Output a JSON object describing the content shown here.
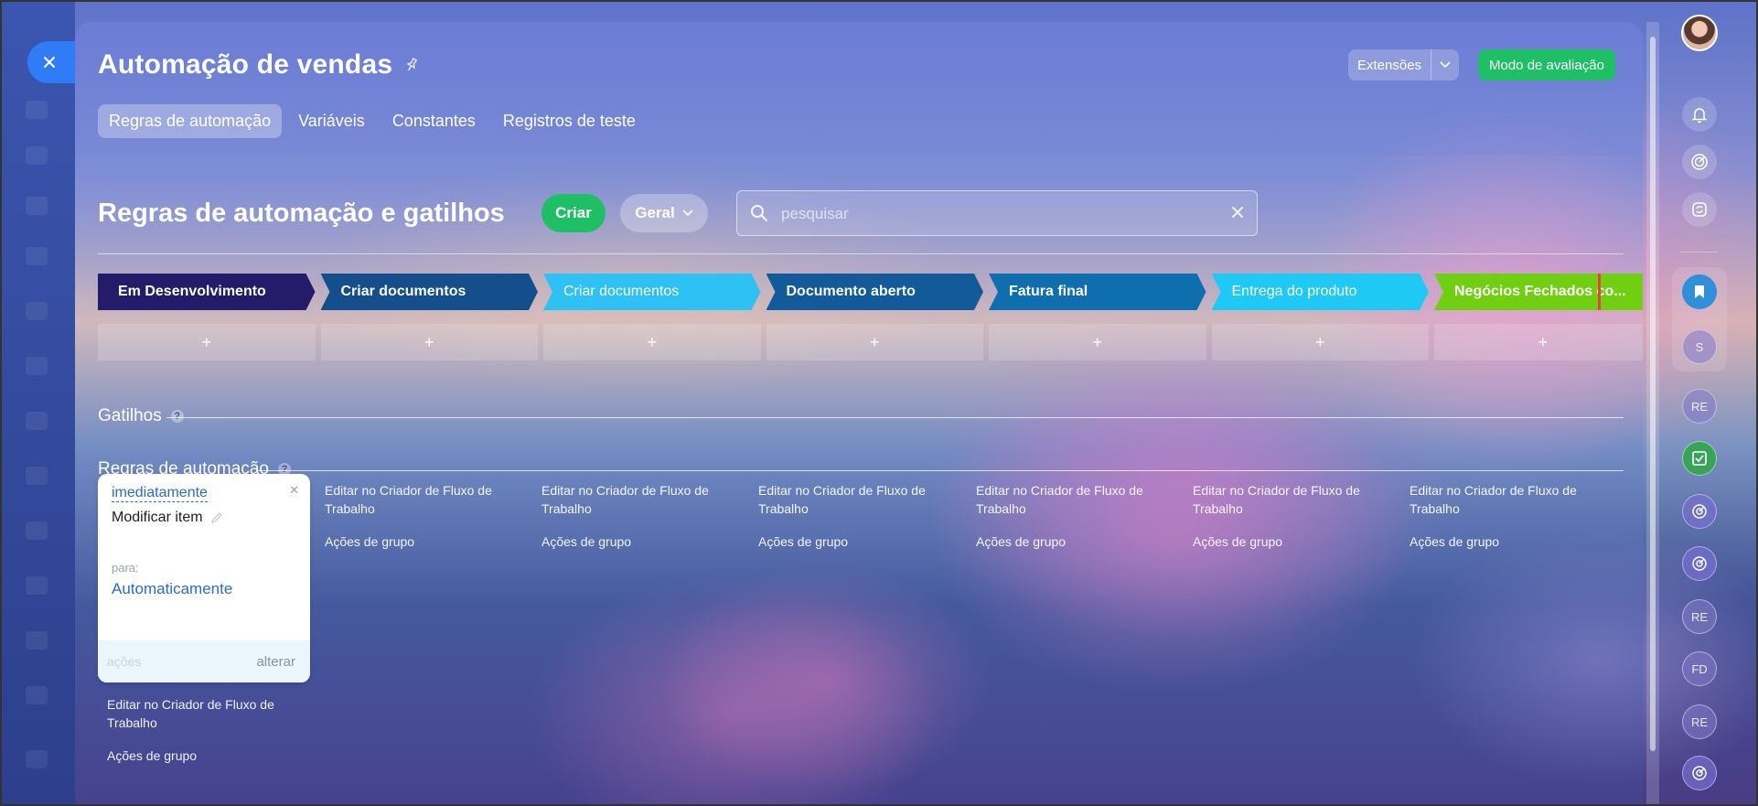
{
  "header": {
    "title": "Automação de vendas",
    "extensions_label": "Extensões",
    "eval_label": "Modo de avaliação",
    "tabs": [
      {
        "label": "Regras de automação",
        "active": true
      },
      {
        "label": "Variáveis",
        "active": false
      },
      {
        "label": "Constantes",
        "active": false
      },
      {
        "label": "Registros de teste",
        "active": false
      }
    ]
  },
  "toolbar": {
    "title": "Regras de automação e gatilhos",
    "create_label": "Criar",
    "filter_label": "Geral",
    "search_placeholder": "pesquisar"
  },
  "stages": [
    {
      "label": "Em Desenvolvimento",
      "color": "#241c6a"
    },
    {
      "label": "Criar documentos",
      "color": "#154e8c"
    },
    {
      "label": "Criar documentos",
      "color": "#2ec2f4"
    },
    {
      "label": "Documento aberto",
      "color": "#125a9a"
    },
    {
      "label": "Fatura final",
      "color": "#0f6fae"
    },
    {
      "label": "Entrega do produto",
      "color": "#1ec9f6"
    },
    {
      "label": "Negócios Fechados co...",
      "color": "#6fcf10"
    }
  ],
  "add_symbol": "+",
  "triggers": {
    "label": "Gatilhos",
    "help": "?"
  },
  "rules": {
    "label": "Regras de automação",
    "help": "?",
    "card": {
      "when": "imediatamente",
      "action": "Modificar item",
      "for_label": "para:",
      "for_value": "Automaticamente",
      "actions_label": "ações",
      "change_label": "alterar"
    },
    "edit_label": "Editar no Criador de Fluxo de Trabalho",
    "group_label": "Ações de grupo"
  },
  "right_rail": {
    "chips": [
      "S",
      "RE",
      "RE",
      "FD",
      "RE"
    ]
  },
  "colors": {
    "accent_green": "#1fbf66",
    "close_blue": "#2f7cf6",
    "link_blue": "#2b6cc4"
  }
}
